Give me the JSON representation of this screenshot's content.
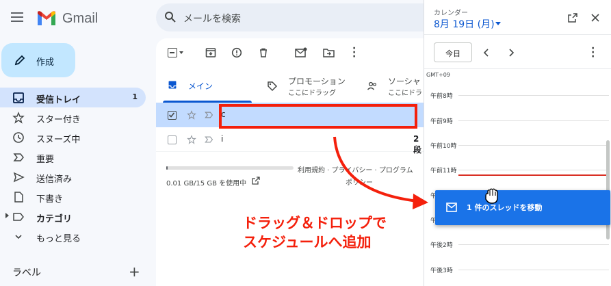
{
  "header": {
    "app_name": "Gmail",
    "search_placeholder": "メールを検索"
  },
  "sidebar": {
    "compose_label": "作成",
    "items": [
      {
        "label": "受信トレイ",
        "icon": "inbox-icon",
        "count": "1",
        "active": true
      },
      {
        "label": "スター付き",
        "icon": "star-icon"
      },
      {
        "label": "スヌーズ中",
        "icon": "clock-icon"
      },
      {
        "label": "重要",
        "icon": "important-icon"
      },
      {
        "label": "送信済み",
        "icon": "send-icon"
      },
      {
        "label": "下書き",
        "icon": "draft-icon"
      },
      {
        "label": "カテゴリ",
        "icon": "label-icon"
      },
      {
        "label": "もっと見る",
        "icon": "chevron-down-icon"
      }
    ],
    "labels_heading": "ラベル"
  },
  "tabs": [
    {
      "label": "メイン",
      "icon": "inbox-icon"
    },
    {
      "label": "プロモーション",
      "sub": "ここにドラッグ",
      "icon": "tag-icon"
    },
    {
      "label": "ソーシャ",
      "sub": "ここにドラ",
      "icon": "people-icon"
    }
  ],
  "rows": [
    {
      "sender": "c",
      "extra": ""
    },
    {
      "sender": "i",
      "extra": "2段"
    }
  ],
  "footer": {
    "storage": "0.01 GB/15 GB を使用中",
    "links": "利用規約 · プライバシー · プログラム",
    "links2": "ポリシー",
    "storage_fraction": 0.0007
  },
  "calendar": {
    "title": "カレンダー",
    "date": "8月 19日 (月)",
    "today_button": "今日",
    "timezone": "GMT+09",
    "hours": [
      "午前8時",
      "午前9時",
      "午前10時",
      "午前11時",
      "午後",
      "午後",
      "午後2時",
      "午後3時"
    ]
  },
  "drag_tooltip": "1 件のスレッドを移動",
  "annotation": {
    "line1": "ドラッグ＆ドロップで",
    "line2": "スケジュールへ追加"
  },
  "colors": {
    "accent": "#0b57d0",
    "annotation": "#f4200c",
    "tooltip": "#1a73e8",
    "now_line": "#d93025"
  }
}
